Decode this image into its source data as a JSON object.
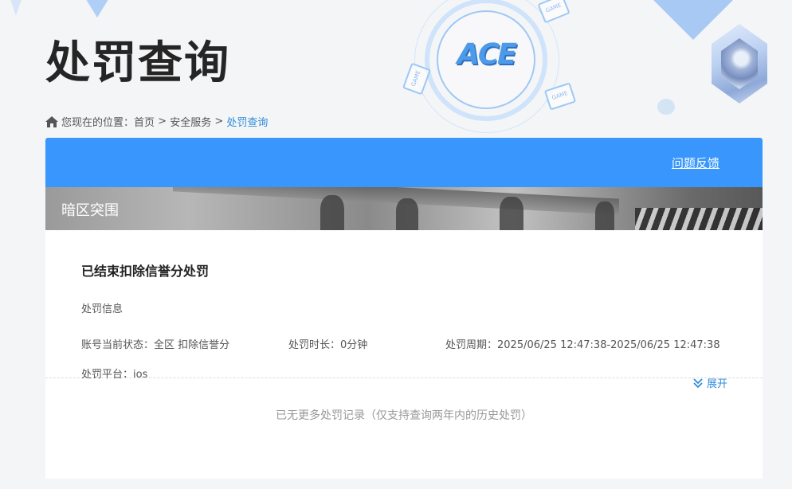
{
  "header": {
    "title": "处罚查询",
    "logo_text": "ACE",
    "deco_tag": "GAME"
  },
  "breadcrumb": {
    "prefix": "您现在的位置：",
    "items": [
      "首页",
      "安全服务"
    ],
    "separator": " > ",
    "current": "处罚查询"
  },
  "toolbar": {
    "feedback_label": "问题反馈"
  },
  "game": {
    "name": "暗区突围"
  },
  "record": {
    "title": "已结束扣除信誉分处罚",
    "section_label": "处罚信息",
    "status_label": "账号当前状态：",
    "status_value": "全区 扣除信誉分",
    "duration_label": "处罚时长：",
    "duration_value": "0分钟",
    "period_label": "处罚周期：",
    "period_value": "2025/06/25 12:47:38-2025/06/25 12:47:38",
    "platform_label": "处罚平台：",
    "platform_value": "ios",
    "expand_label": "展开"
  },
  "footer_note": "已无更多处罚记录（仅支持查询两年内的历史处罚）",
  "colors": {
    "accent": "#3896fc",
    "link": "#2f8cd8"
  }
}
